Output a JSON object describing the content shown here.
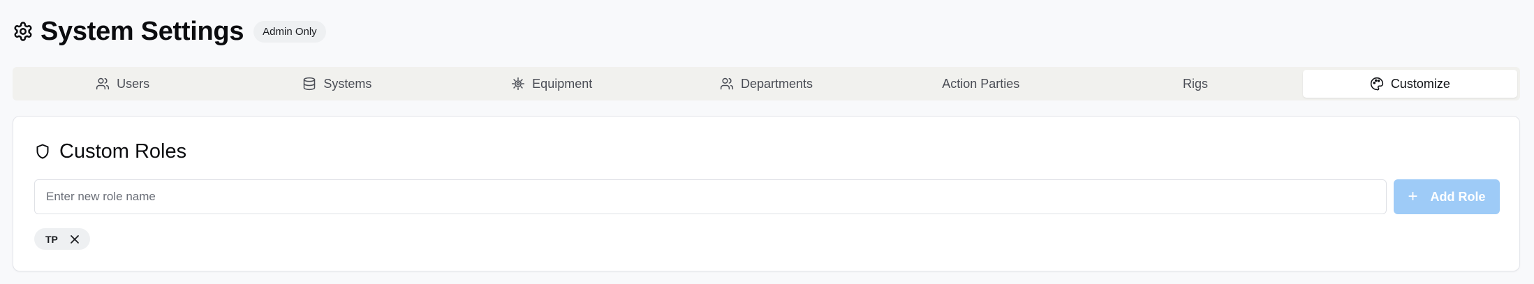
{
  "header": {
    "title": "System Settings",
    "badge": "Admin Only",
    "icon": "gear-icon"
  },
  "tabs": [
    {
      "label": "Users",
      "icon": "users-icon",
      "active": false
    },
    {
      "label": "Systems",
      "icon": "database-icon",
      "active": false
    },
    {
      "label": "Equipment",
      "icon": "cog-icon",
      "active": false
    },
    {
      "label": "Departments",
      "icon": "users-icon",
      "active": false
    },
    {
      "label": "Action Parties",
      "icon": "",
      "active": false
    },
    {
      "label": "Rigs",
      "icon": "",
      "active": false
    },
    {
      "label": "Customize",
      "icon": "palette-icon",
      "active": true
    }
  ],
  "custom_roles": {
    "title": "Custom Roles",
    "icon": "shield-icon",
    "input_placeholder": "Enter new role name",
    "input_value": "",
    "add_button_label": "Add Role",
    "add_button_color": "#9ecbf7",
    "roles": [
      {
        "label": "TP"
      }
    ]
  }
}
